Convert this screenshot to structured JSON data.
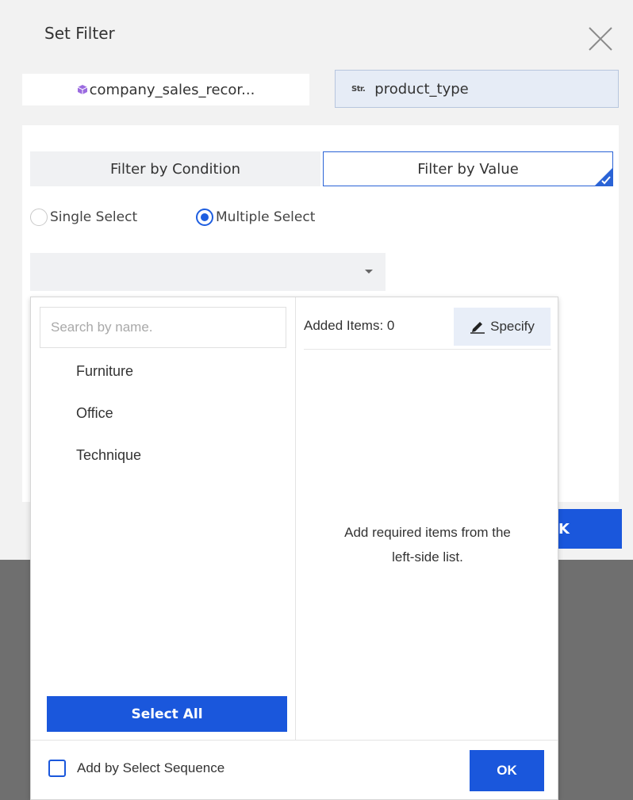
{
  "dialog": {
    "title": "Set Filter",
    "source_name": "company_sales_recor...",
    "field_type_badge": "Str.",
    "field_name": "product_type",
    "ok_label_partial": "K"
  },
  "tabs": {
    "by_condition": "Filter by Condition",
    "by_value": "Filter by Value",
    "active": "by_value"
  },
  "select_mode": {
    "single_label": "Single Select",
    "multiple_label": "Multiple Select",
    "selected": "multiple"
  },
  "value_picker": {
    "search_placeholder": "Search by name.",
    "items": [
      "Furniture",
      "Office",
      "Technique"
    ],
    "select_all_label": "Select All",
    "added_label": "Added Items: 0",
    "specify_label": "Specify",
    "empty_hint_line1": "Add required items from the",
    "empty_hint_line2": "left-side list.",
    "sequence_label": "Add by Select Sequence",
    "sequence_checked": false,
    "ok_label": "OK"
  },
  "colors": {
    "accent": "#1a57dc",
    "field_chip_bg": "#e6ecf6",
    "source_icon": "#9b6be0"
  },
  "icons": [
    "close-icon",
    "cube-icon",
    "check-icon",
    "dropdown-arrow-icon",
    "pen-icon"
  ]
}
